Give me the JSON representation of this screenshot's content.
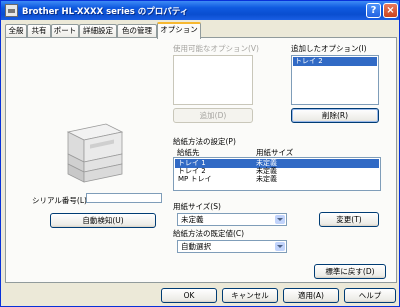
{
  "window": {
    "title": "Brother HL-XXXX series のプロパティ",
    "help_glyph": "?",
    "close_glyph": "×"
  },
  "tabs": [
    {
      "label": "全般"
    },
    {
      "label": "共有"
    },
    {
      "label": "ポート"
    },
    {
      "label": "詳細設定"
    },
    {
      "label": "色の管理"
    },
    {
      "label": "オプション",
      "active": true
    }
  ],
  "options": {
    "available_label": "使用可能なオプション(V)",
    "installed_label": "追加したオプション(I)",
    "installed_items": [
      "トレイ 2"
    ],
    "add_button": "追加(D)",
    "remove_button": "削除(R)"
  },
  "paper_source": {
    "label": "給紙方法の設定(P)",
    "col_source": "給紙先",
    "col_size": "用紙サイズ",
    "rows": [
      {
        "source": "トレイ 1",
        "size": "未定義",
        "selected": true
      },
      {
        "source": "トレイ 2",
        "size": "未定義"
      },
      {
        "source": "MP トレイ",
        "size": "未定義"
      }
    ],
    "paper_size_label": "用紙サイズ(S)",
    "paper_size_value": "未定義",
    "change_button": "変更(T)",
    "default_source_label": "給紙方法の既定値(C)",
    "default_source_value": "自動選択"
  },
  "serial": {
    "label": "シリアル番号(L)",
    "value": ""
  },
  "auto_detect_button": "自動検知(U)",
  "restore_defaults_button": "標準に戻す(D)",
  "footer": {
    "ok": "OK",
    "cancel": "キャンセル",
    "apply": "適用(A)",
    "help": "ヘルプ"
  }
}
